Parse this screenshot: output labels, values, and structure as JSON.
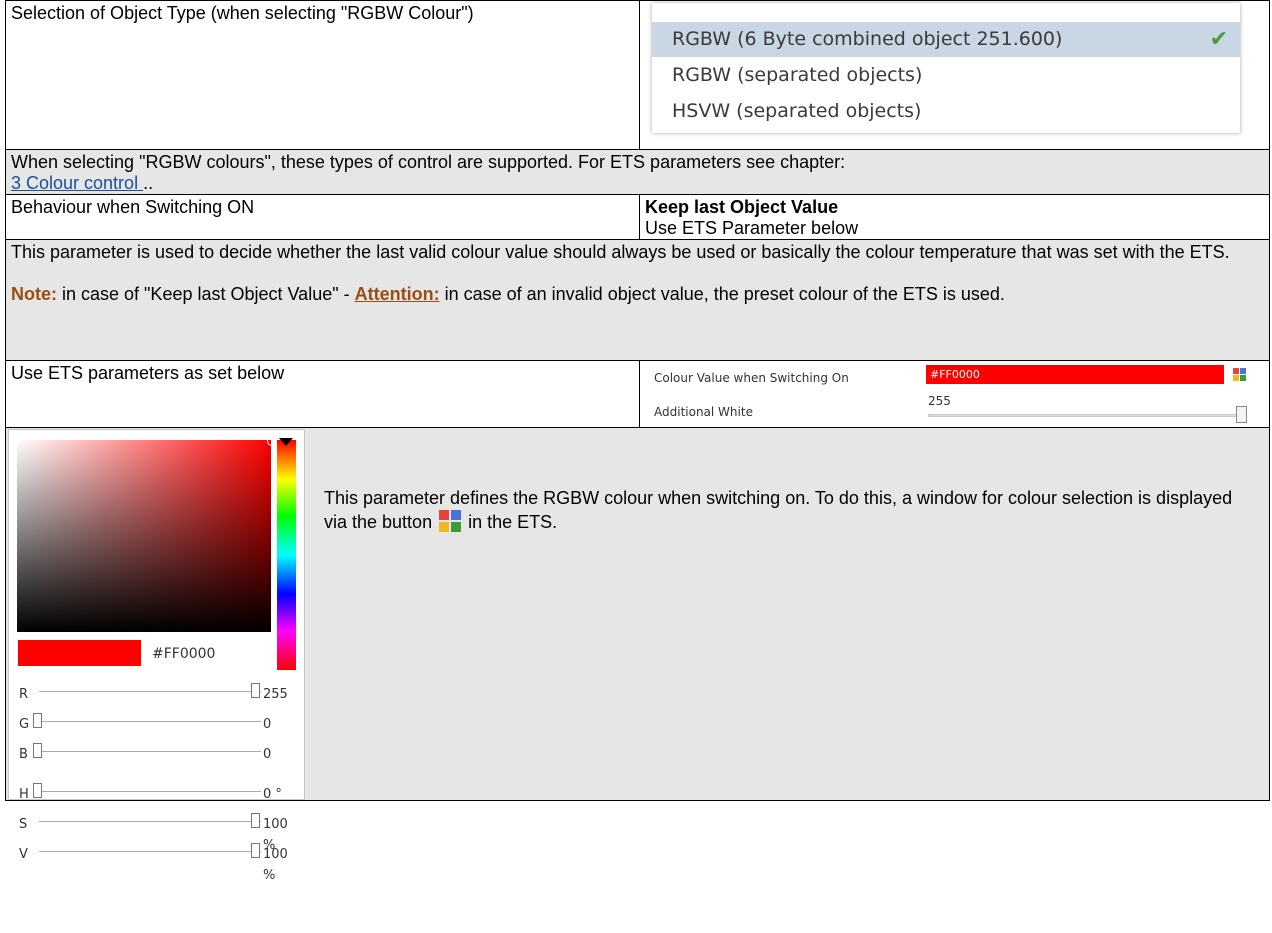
{
  "rows": {
    "object_type": {
      "label": "Selection of Object Type (when selecting \"RGBW Colour\")",
      "options": [
        {
          "label": "RGBW (6 Byte combined object 251.600)",
          "selected": true
        },
        {
          "label": "RGBW (separated objects)",
          "selected": false
        },
        {
          "label": "HSVW (separated objects)",
          "selected": false
        }
      ],
      "check_icon": "checkmark-icon"
    },
    "colour_types_desc": {
      "text": "When selecting \"RGBW colours\", these types of control are supported. For ETS parameters see chapter:",
      "link": "3 Colour control ",
      "suffix": ".."
    },
    "switch_on": {
      "label": "Behaviour when Switching ON",
      "option_bold": "Keep last Object Value",
      "option_2": "Use ETS Parameter below"
    },
    "switch_on_desc": {
      "text": "This parameter is used to decide whether the last valid colour value should always be used or basically the colour temperature that was set with the ETS.",
      "note_label": "Note:",
      "note_text": " in case of \"Keep last Object Value\" - ",
      "attention_label": "Attention:",
      "attention_text": " in case of an invalid object value, the preset colour of the ETS is used."
    },
    "ets_params": {
      "label": "Use ETS parameters as set below",
      "colour_label": "Colour Value when Switching On",
      "colour_value": "#FF0000",
      "white_label": "Additional White",
      "white_value": "255"
    },
    "picker_desc": {
      "text_before": "This parameter defines the RGBW colour when switching on. To do this, a window for colour selection is displayed via the button ",
      "text_after": " in the ETS."
    }
  },
  "picker": {
    "hex": "#FF0000",
    "sliders": [
      {
        "label": "R",
        "value": "255",
        "fraction": 1.0
      },
      {
        "label": "G",
        "value": "0",
        "fraction": 0.0
      },
      {
        "label": "B",
        "value": "0",
        "fraction": 0.0
      },
      {
        "label": "H",
        "value": "0 °",
        "fraction": 0.0
      },
      {
        "label": "S",
        "value": "100 %",
        "fraction": 1.0
      },
      {
        "label": "V",
        "value": "100 %",
        "fraction": 1.0
      }
    ]
  },
  "colors": {
    "selected_bg": "#c9d6e3",
    "link": "#1a4fa0",
    "note": "#9a4d12",
    "preset_colour": "#ff0000",
    "cell_grey": "#e6e6e6"
  }
}
